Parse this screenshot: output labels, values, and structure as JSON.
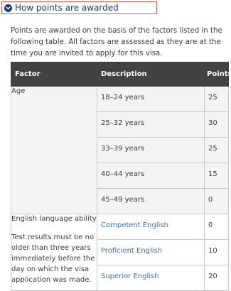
{
  "accordion": {
    "title": "How points are awarded",
    "icon": "chevron-down-circle-icon",
    "icon_color": "#1e3a78",
    "border_color": "#d9534f"
  },
  "intro": "Points are awarded on the basis of the factors listed in the following table. All factors are assessed as they are at the time you are invited to apply for this visa.",
  "table": {
    "header_bg": "#424242",
    "headers": [
      "Factor",
      "Description",
      "Points"
    ],
    "age": {
      "factor": "Age",
      "rows": [
        {
          "description": "18–24 years",
          "points": "25"
        },
        {
          "description": "25–32 years",
          "points": "30"
        },
        {
          "description": "33–39 years",
          "points": "25"
        },
        {
          "description": "40–44 years",
          "points": "15"
        },
        {
          "description": "45–49 years",
          "points": "0"
        }
      ]
    },
    "english": {
      "factor": "English language ability",
      "note": "Test results must be no older than three years immediately before the day on which the visa application was made.",
      "link_color": "#3d6fb6",
      "rows": [
        {
          "description": "Competent English",
          "points": "0"
        },
        {
          "description": "Proficient English",
          "points": "10"
        },
        {
          "description": "Superior English",
          "points": "20"
        }
      ]
    }
  }
}
